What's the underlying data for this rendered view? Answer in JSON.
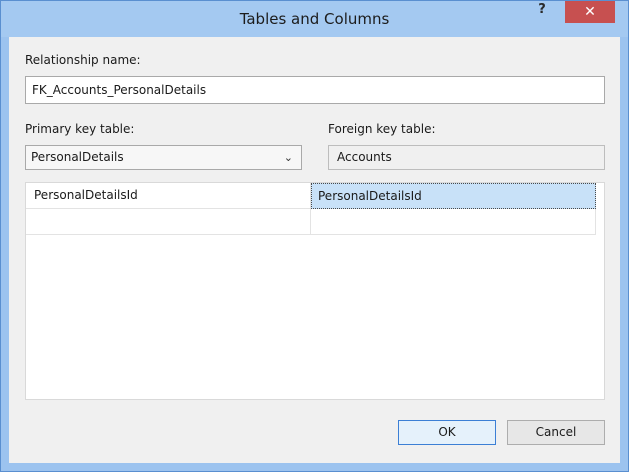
{
  "window": {
    "title": "Tables and Columns",
    "help_label": "?",
    "close_label": "✕"
  },
  "relationship": {
    "label": "Relationship name:",
    "value": "FK_Accounts_PersonalDetails"
  },
  "primary": {
    "label": "Primary key table:",
    "selected": "PersonalDetails"
  },
  "foreign": {
    "label": "Foreign key table:",
    "value": "Accounts"
  },
  "columns": {
    "rows": [
      {
        "primary": "PersonalDetailsId",
        "foreign": "PersonalDetailsId"
      },
      {
        "primary": "",
        "foreign": ""
      }
    ]
  },
  "buttons": {
    "ok": "OK",
    "cancel": "Cancel"
  },
  "colors": {
    "title_bar": "#a4c9f1",
    "close_button": "#c75050",
    "selection": "#c8e1f8",
    "default_button_border": "#3c7fd5"
  }
}
